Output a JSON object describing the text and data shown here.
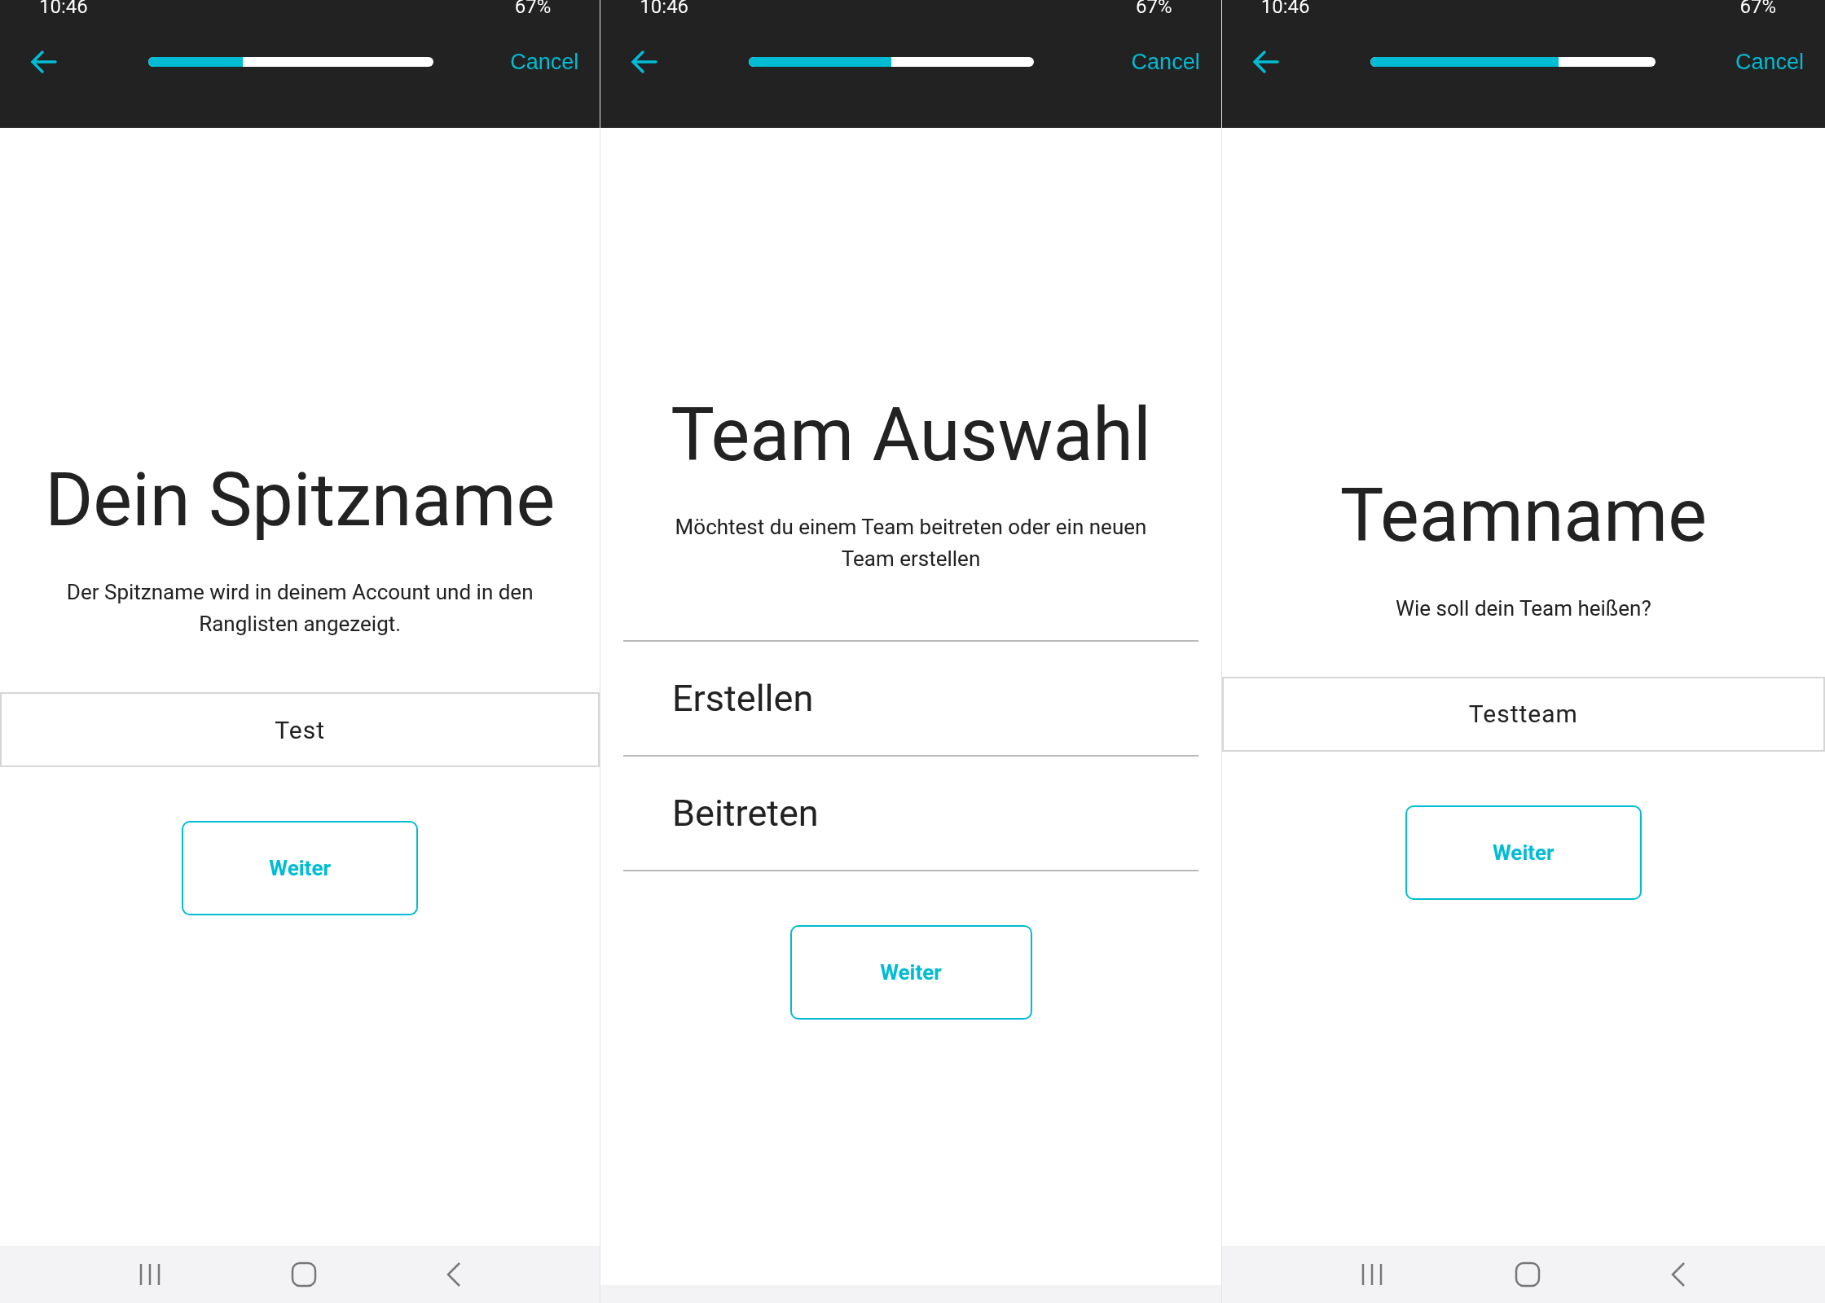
{
  "screens": [
    {
      "kind": "input",
      "status_bar": {
        "time": "10:46",
        "battery": "67%"
      },
      "toolbar": {
        "cancel": "Cancel",
        "level": 0.33
      },
      "title": "Dein Spitzname",
      "description": "Der Spitzname wird in deinem Account und in den Ranglisten angezeigt.",
      "field": {
        "value": "Test"
      },
      "button": "Weiter",
      "navigation_bar": {
        "buttons_visible": true
      }
    },
    {
      "kind": "choice",
      "status_bar": {
        "time": "10:46",
        "battery": "67%"
      },
      "toolbar": {
        "cancel": "Cancel",
        "level": 0.5
      },
      "title": "Team Auswahl",
      "description": "Möchtest du einem Team beitreten oder ein neuen Team erstellen",
      "options": [
        {
          "label": "Erstellen",
          "selected": false
        },
        {
          "label": "Beitreten",
          "selected": false
        }
      ],
      "button": "Weiter",
      "navigation_bar": {
        "buttons_visible": false
      }
    },
    {
      "kind": "input",
      "status_bar": {
        "time": "10:46",
        "battery": "67%"
      },
      "toolbar": {
        "cancel": "Cancel",
        "level": 0.66
      },
      "title": "Teamname",
      "description": "Wie soll dein Team heißen?",
      "field": {
        "value": "Testteam"
      },
      "button": "Weiter",
      "navigation_bar": {
        "buttons_visible": true
      }
    }
  ]
}
